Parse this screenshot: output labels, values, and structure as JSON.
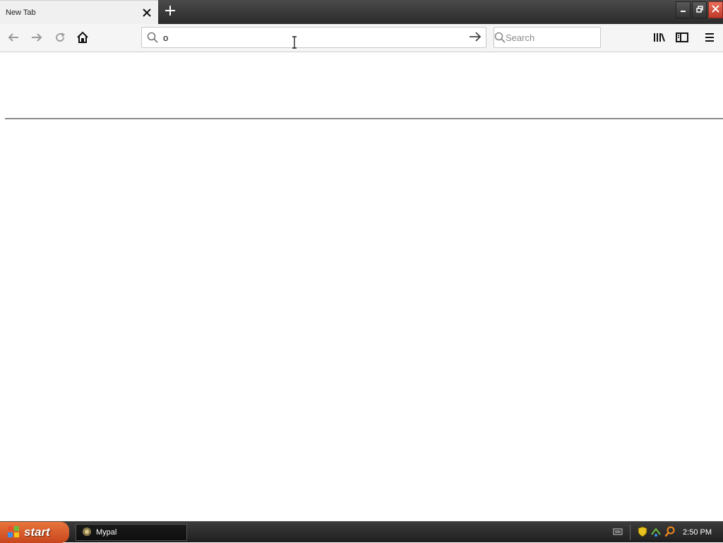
{
  "tab": {
    "title": "New Tab"
  },
  "urlbar": {
    "value": "o"
  },
  "searchbar": {
    "placeholder": "Search"
  },
  "taskbar": {
    "start_label": "start",
    "task_item_label": "Mypal",
    "clock": "2:50 PM"
  },
  "colors": {
    "tabstrip": "#2b2b2b",
    "start_button": "#d75a2a",
    "close_button": "#c0392b"
  },
  "icons": {
    "tab_close": "close-icon",
    "new_tab": "plus-icon",
    "back": "back-arrow-icon",
    "forward": "forward-arrow-icon",
    "reload": "reload-icon",
    "home": "home-icon",
    "go": "go-arrow-icon",
    "library": "library-icon",
    "sidebar": "sidebar-icon",
    "menu": "hamburger-menu-icon"
  }
}
